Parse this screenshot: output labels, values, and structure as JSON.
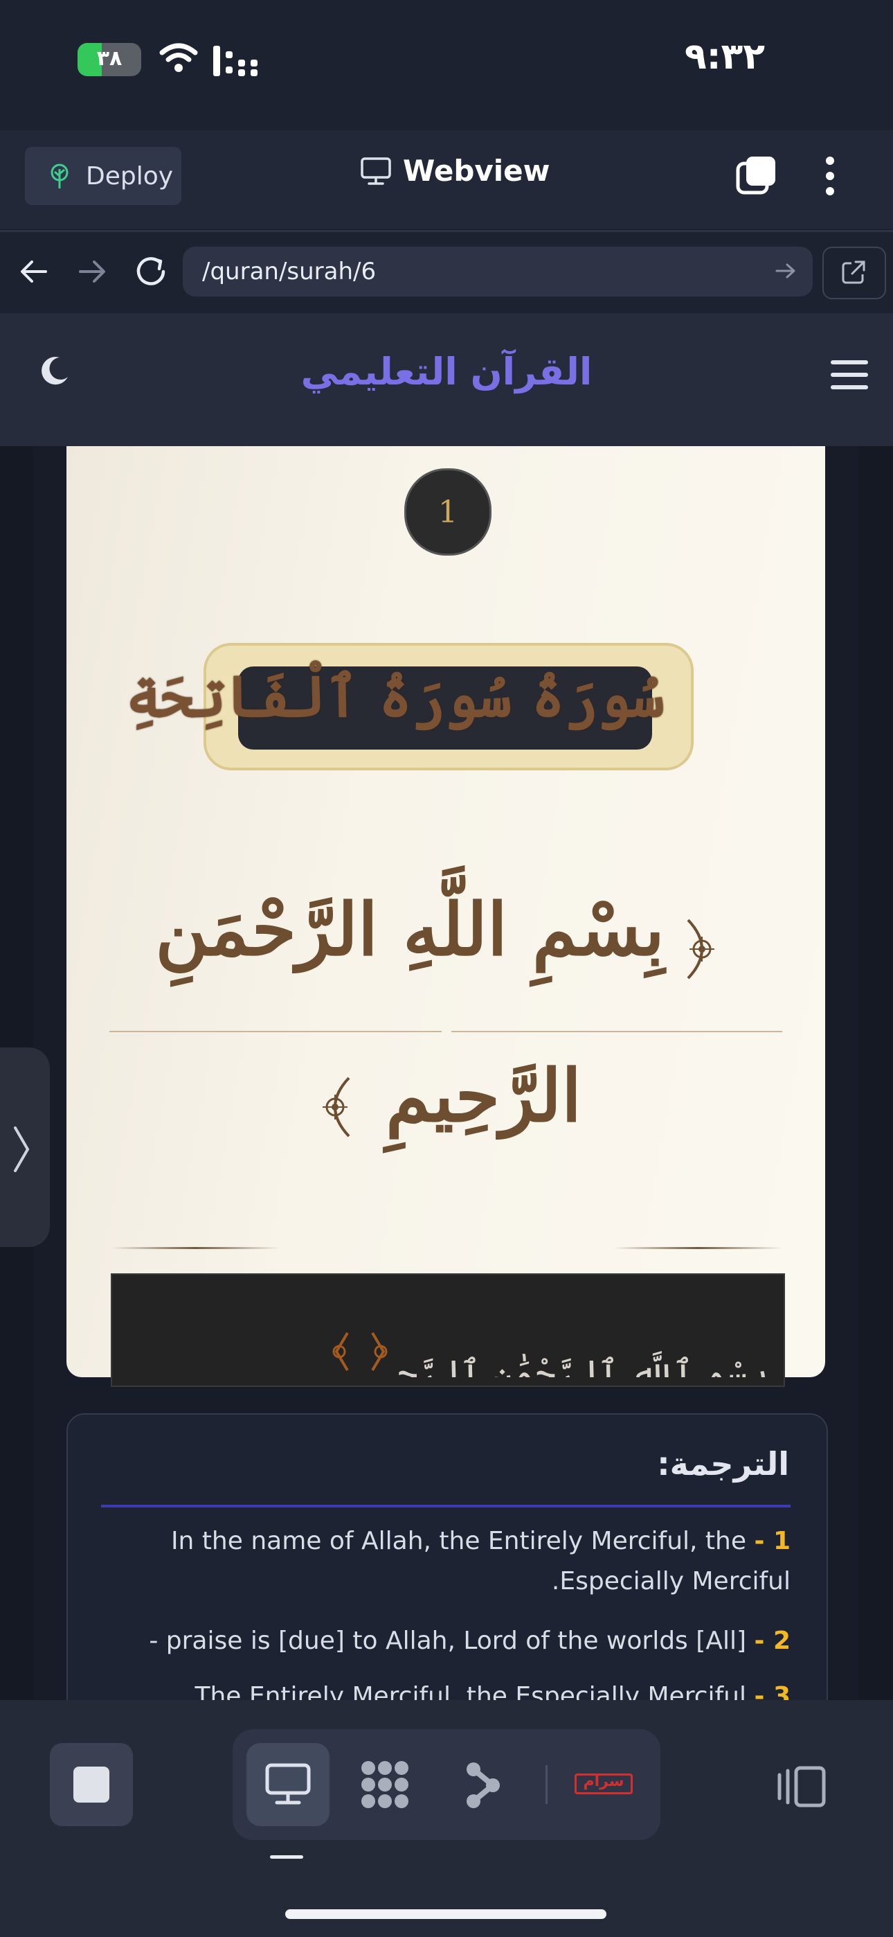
{
  "status_bar": {
    "time": "٩:٣٢",
    "battery_text": "٣٨",
    "battery_level": 0.38,
    "battery_color": "#34c759"
  },
  "toolbar": {
    "deploy_label": "Deploy",
    "deploy_icon": "tree-icon",
    "title": "Webview",
    "title_icon": "monitor-icon",
    "tabs_icon": "tabs-icon",
    "menu_icon": "more-vertical-icon"
  },
  "nav": {
    "back_icon": "arrow-left-icon",
    "forward_icon": "arrow-right-icon",
    "reload_icon": "reload-icon",
    "url": "/quran/surah/6",
    "go_icon": "arrow-right-icon",
    "external_icon": "external-link-icon"
  },
  "app": {
    "title": "القرآن التعليمي",
    "theme_icon": "moon-icon",
    "menu_icon": "hamburger-icon",
    "accent_color": "#7a70e6"
  },
  "surah": {
    "number": "1",
    "name": "سُورَةُ سُورَةُ ٱلْفَاتِحَةِ",
    "bismillah_line1": "بِسْمِ اللَّهِ الرَّحْمَنِ",
    "bismillah_line2": "الرَّحِيمِ",
    "ayah_preview": "بِسْمِ ٱللَّهِ ٱلرَّحْمَٰنِ ٱلرَّحِيمِ",
    "text_color": "#6e4e30"
  },
  "translation": {
    "heading": "الترجمة:",
    "items": [
      {
        "num": "1 -",
        "text": "In the name of Allah, the Entirely Merciful, the Especially Merciful."
      },
      {
        "num": "2 -",
        "text": "[All] praise is [due] to Allah, Lord of the worlds -"
      },
      {
        "num": "3 -",
        "text": "The Entirely Merciful, the Especially Merciful,"
      }
    ],
    "number_color": "#f2b826"
  },
  "bottom_bar": {
    "stop_icon": "stop-icon",
    "buttons": [
      "monitor-icon",
      "grid-dots-icon",
      "share-nodes-icon",
      "badge-icon"
    ],
    "badge_text": "سرام",
    "panel_icon": "split-panel-icon"
  },
  "drawer": {
    "handle_icon": "chevron-right-icon"
  }
}
